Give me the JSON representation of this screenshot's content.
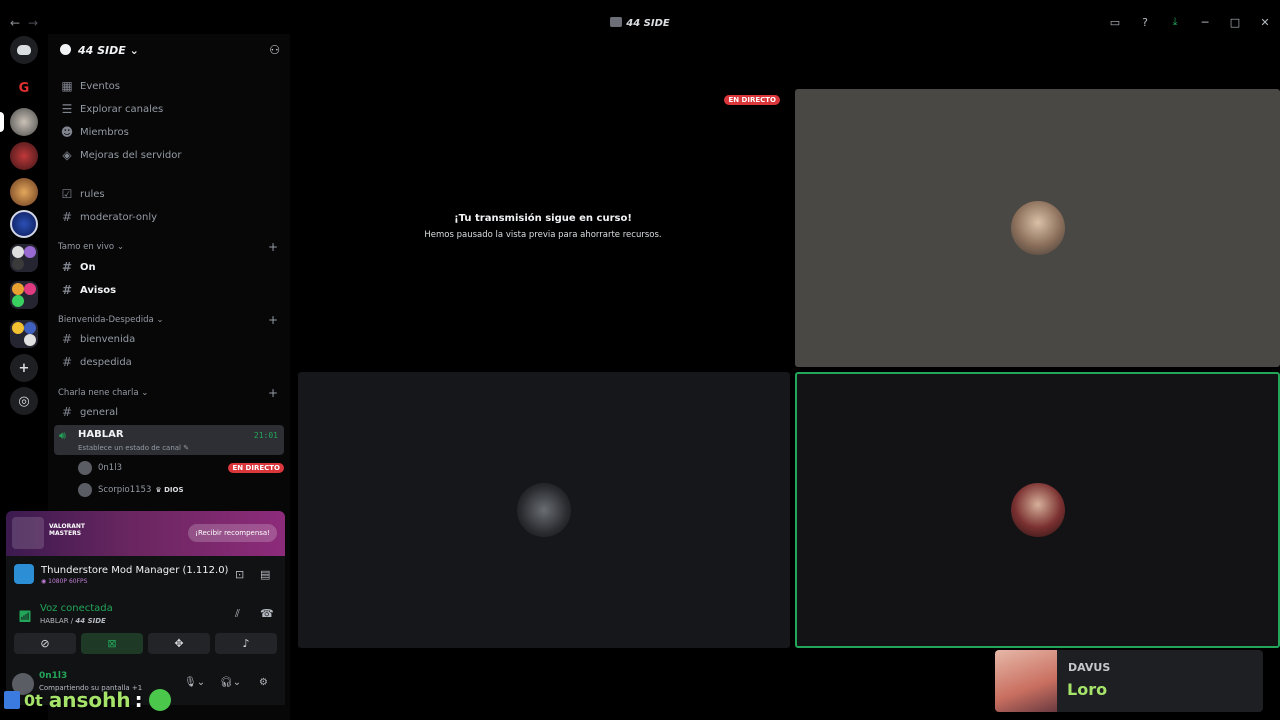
{
  "window": {
    "title": "44 SIDE",
    "back_icon": "←",
    "forward_icon": "→"
  },
  "server": {
    "name": "44 SIDE"
  },
  "nav_links": [
    {
      "label": "Eventos",
      "icon": "calendar-icon"
    },
    {
      "label": "Explorar canales",
      "icon": "channels-icon"
    },
    {
      "label": "Miembros",
      "icon": "members-icon"
    },
    {
      "label": "Mejoras del servidor",
      "icon": "boost-icon"
    }
  ],
  "channels_top": [
    {
      "label": "rules",
      "icon": "rules-icon"
    },
    {
      "label": "moderator-only",
      "icon": "hash-icon"
    }
  ],
  "categories": [
    {
      "label": "Tamo en vivo",
      "channels": [
        "On",
        "Avisos"
      ]
    },
    {
      "label": "Bienvenida-Despedida",
      "channels": [
        "bienvenida",
        "despedida"
      ]
    },
    {
      "label": "Charla nene charla",
      "channels": [
        "general"
      ]
    }
  ],
  "voice_channel": {
    "name": "HABLAR",
    "status": "Establece un estado de canal",
    "time": "21:01",
    "users": [
      {
        "name": "0n1l3",
        "badge": "EN DIRECTO"
      },
      {
        "name": "Scorpio1153",
        "role": "DIOS"
      }
    ]
  },
  "promo": {
    "title": "VALORANT MASTERS",
    "button": "¡Recibir recompensa!"
  },
  "stream": {
    "title": "Thunderstore Mod Manager (1.112.0) - ...",
    "quality": "1080P 60FPS"
  },
  "voice_connection": {
    "title": "Voz conectada",
    "channel": "HABLAR",
    "server": "44 SIDE"
  },
  "user": {
    "name": "0n1l3",
    "status": "Compartiendo su pantalla +1"
  },
  "stage": {
    "live_badge": "EN DIRECTO",
    "paused_title": "¡Tu transmisión sigue en curso!",
    "paused_subtitle": "Hemos pausado la vista previa para ahorrarte recursos."
  },
  "overlay": {
    "chat_prefix": "0t",
    "chat_name": "ansohh",
    "chat_colon": ":"
  },
  "now_playing": {
    "artist": "DAVUS",
    "song": "Loro"
  },
  "colors": {
    "accent_green": "#23a55a",
    "live_red": "#da373c",
    "background": "#000000"
  }
}
